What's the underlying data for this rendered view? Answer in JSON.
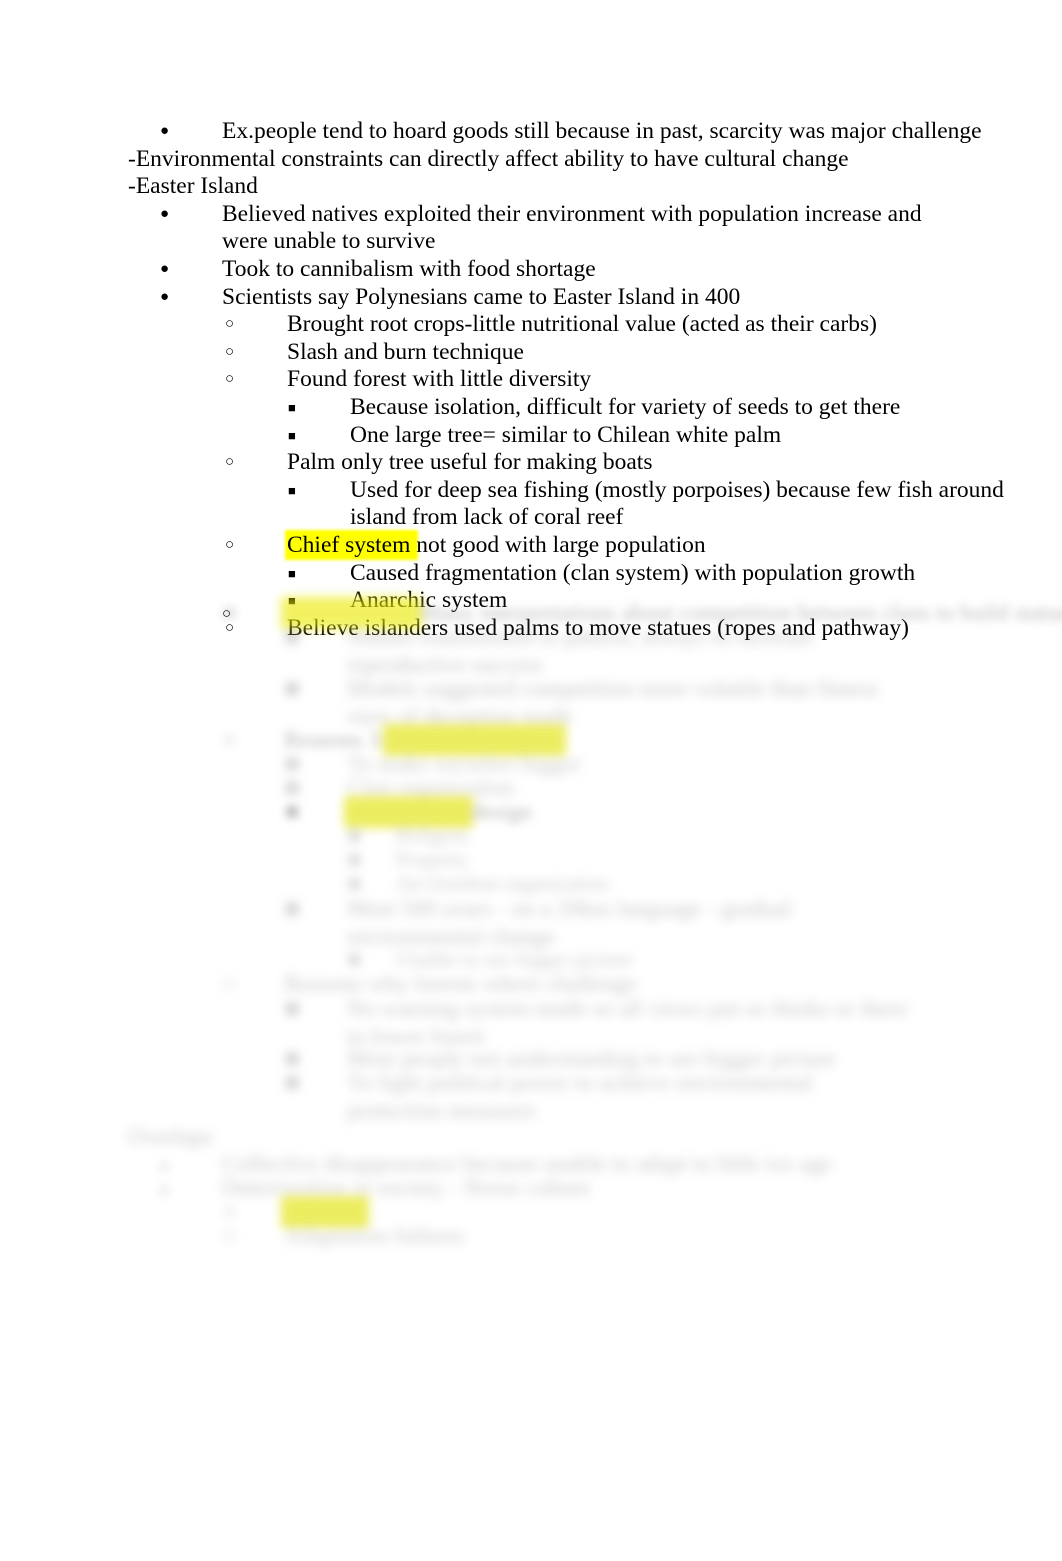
{
  "document": {
    "page_background": "#ffffff",
    "text_color": "#000000",
    "highlight_color": "#ffff00",
    "blocks": [
      {
        "id": "b0",
        "level": 1,
        "bullet": "filled-disc",
        "text": "Ex.people tend to hoard goods still because in past, scarcity was major challenge",
        "blurred": false
      },
      {
        "id": "b1",
        "level": 0,
        "bullet": "dash",
        "text": "-Environmental constraints can directly affect ability to have cultural change",
        "blurred": false
      },
      {
        "id": "b2",
        "level": 0,
        "bullet": "dash",
        "text": "-Easter Island",
        "blurred": false
      },
      {
        "id": "b3",
        "level": 1,
        "bullet": "filled-disc",
        "text": "Believed natives exploited their environment with population increase and were unable to survive",
        "blurred": false
      },
      {
        "id": "b4",
        "level": 1,
        "bullet": "filled-disc",
        "text": "Took to cannibalism with food shortage",
        "blurred": false
      },
      {
        "id": "b5",
        "level": 1,
        "bullet": "filled-disc",
        "text": "Scientists say Polynesians came to Easter Island in 400",
        "blurred": false
      },
      {
        "id": "b6",
        "level": 2,
        "bullet": "hollow-circle",
        "text": "Brought root crops-little nutritional value (acted as their carbs)",
        "blurred": false
      },
      {
        "id": "b7",
        "level": 2,
        "bullet": "hollow-circle",
        "text": "Slash and burn technique",
        "blurred": false
      },
      {
        "id": "b8",
        "level": 2,
        "bullet": "hollow-circle",
        "text": "Found forest with little diversity",
        "blurred": false
      },
      {
        "id": "b9",
        "level": 3,
        "bullet": "filled-square",
        "text": "Because isolation, difficult for variety of seeds to get there",
        "blurred": false
      },
      {
        "id": "b10",
        "level": 3,
        "bullet": "filled-square",
        "text": "One large tree= similar to Chilean white palm",
        "blurred": false
      },
      {
        "id": "b11",
        "level": 2,
        "bullet": "hollow-circle",
        "text": "Palm only tree useful for making boats",
        "blurred": false
      },
      {
        "id": "b12",
        "level": 3,
        "bullet": "filled-square",
        "text": "Used for deep sea fishing (mostly porpoises) because few fish around island from lack of coral reef",
        "blurred": false
      },
      {
        "id": "b13",
        "level": 2,
        "bullet": "hollow-circle",
        "highlighted_prefix": "Chief system ",
        "text_rest": "not good with large population",
        "blurred": false
      },
      {
        "id": "b14",
        "level": 3,
        "bullet": "filled-square",
        "text": "Caused fragmentation (clan system) with population growth",
        "blurred": false
      },
      {
        "id": "b15",
        "level": 3,
        "bullet": "filled-square",
        "text": "Anarchic system",
        "blurred": false
      },
      {
        "id": "b16",
        "level": 2,
        "bullet": "hollow-circle",
        "text": "Believe islanders used palms to move statues (ropes and pathway)",
        "blurred": false
      }
    ],
    "blurred_blocks": [
      {
        "id": "x0",
        "level": 2,
        "bullet": "hollow-circle",
        "highlight_len": 18,
        "filler": "Many interpretations about competition between clans to build statues",
        "blurred": true
      },
      {
        "id": "x1",
        "level": 3,
        "bullet": "filled-square",
        "filler": "Statues transformed in pattern, always to increase reproductive success",
        "blurred": true
      },
      {
        "id": "x2",
        "level": 3,
        "bullet": "filled-square",
        "filler": "Models suggested competition more volatile than fitness view of deception made",
        "blurred": true
      },
      {
        "id": "x3",
        "level": 2,
        "bullet": "hollow-circle",
        "lead": "Reasons 3:",
        "highlight_len": 24,
        "filler": "",
        "blurred": true
      },
      {
        "id": "x4",
        "level": 3,
        "bullet": "filled-square",
        "filler": "To make societies bigger",
        "blurred": true
      },
      {
        "id": "x5",
        "level": 3,
        "bullet": "filled-square",
        "filler": "Clan organization",
        "blurred": true
      },
      {
        "id": "x6",
        "level": 3,
        "bullet": "filled-square",
        "highlight_len": 17,
        "trail": "design",
        "blurred": true
      },
      {
        "id": "x7",
        "level": 4,
        "bullet": "filled-square-small",
        "filler": "Religion",
        "blurred": true
      },
      {
        "id": "x8",
        "level": 4,
        "bullet": "filled-square-small",
        "filler": "Property",
        "blurred": true
      },
      {
        "id": "x9",
        "level": 4,
        "bullet": "filled-square-small",
        "filler": "Art freedom organization",
        "blurred": true
      },
      {
        "id": "x10",
        "level": 3,
        "bullet": "filled-square",
        "filler": "Most 500 years - on a 20km language - gradual environmental change",
        "blurred": true
      },
      {
        "id": "x11",
        "level": 4,
        "bullet": "filled-square-small",
        "filler": "Unable to see bigger picture",
        "blurred": true
      },
      {
        "id": "x12",
        "level": 2,
        "bullet": "hollow-circle",
        "filler": "Reasons why forests where challenge",
        "blurred": true
      },
      {
        "id": "x13",
        "level": 3,
        "bullet": "filled-square",
        "filler": "No warning system made so all views put so thinks or there to lower forest",
        "blurred": true
      },
      {
        "id": "x14",
        "level": 3,
        "bullet": "filled-square",
        "filler": "Most people not understanding to see bigger picture",
        "blurred": true
      },
      {
        "id": "x15",
        "level": 3,
        "bullet": "filled-square",
        "filler": "To fight political power to achieve environmental protection measures",
        "blurred": true
      },
      {
        "id": "x16",
        "level": 0,
        "bullet": "none",
        "filler": "Overlaps",
        "blurred": true
      },
      {
        "id": "x17",
        "level": 1,
        "bullet": "filled-disc",
        "filler": "Collective disappearance because unable to adapt to little ice age",
        "blurred": true
      },
      {
        "id": "x18",
        "level": 1,
        "bullet": "filled-disc",
        "filler": "Deterioration in society - Norse culture",
        "blurred": true
      },
      {
        "id": "x19",
        "level": 2,
        "bullet": "hollow-circle",
        "highlight_len": 11,
        "blurred": true
      },
      {
        "id": "x20",
        "level": 2,
        "bullet": "hollow-circle",
        "filler": "Adaptation failures",
        "blurred": true
      }
    ]
  }
}
